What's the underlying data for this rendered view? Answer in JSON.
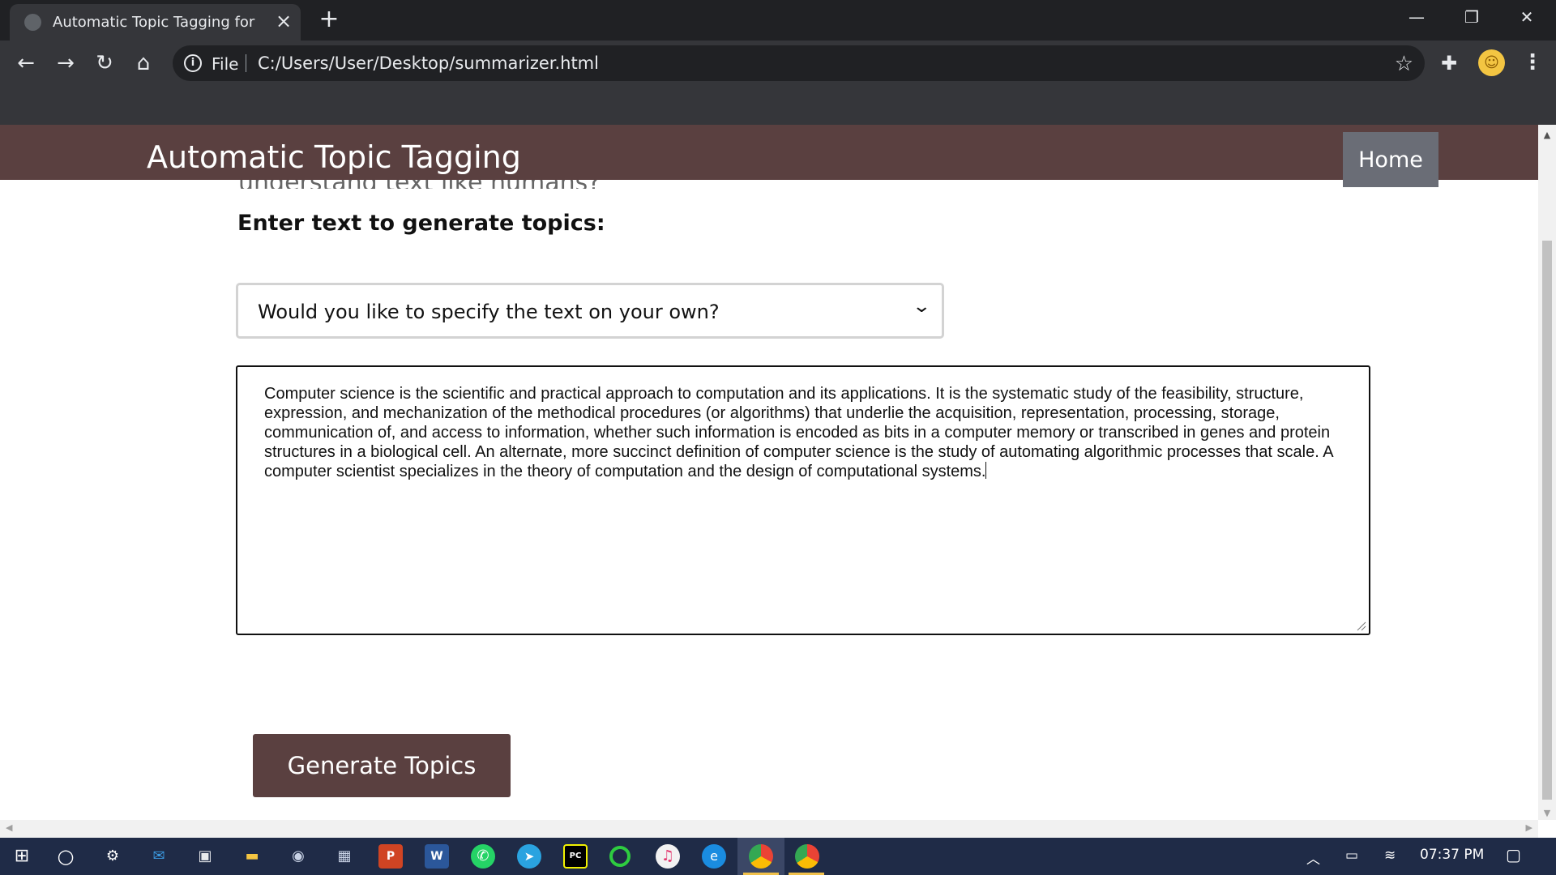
{
  "browser": {
    "tab_title": "Automatic Topic Tagging for Doc",
    "scheme_label": "File",
    "url": "C:/Users/User/Desktop/summarizer.html"
  },
  "page": {
    "brand": "Automatic Topic Tagging",
    "nav_home": "Home",
    "peek_text": "understand text like humans?",
    "section_title": "Enter text to generate topics:",
    "select_value": "Would you like to specify the text on your own?",
    "textarea_value": "Computer science is the scientific and practical approach to computation and its applications. It is the systematic study of the feasibility, structure, expression, and mechanization of the methodical procedures (or algorithms) that underlie the acquisition, representation, processing, storage, communication of, and access to information, whether such information is encoded as bits in a computer memory or transcribed in genes and protein structures in a biological cell. An alternate, more succinct definition of computer science is the study of automating algorithmic processes that scale. A computer scientist specializes in the theory of computation and the design of computational systems.",
    "generate_button": "Generate Topics"
  },
  "taskbar": {
    "clock": "07:37 PM",
    "apps": [
      "start",
      "cortana",
      "settings",
      "mail",
      "store",
      "file-explorer",
      "camera",
      "calculator",
      "powerpoint",
      "word",
      "whatsapp",
      "telegram",
      "pycharm",
      "circle-app",
      "itunes",
      "edge",
      "chrome",
      "chrome-profile"
    ]
  },
  "colors": {
    "header": "#5a4040",
    "home_link": "#6a6d76",
    "button": "#5a4040",
    "taskbar": "#1f2b47"
  }
}
